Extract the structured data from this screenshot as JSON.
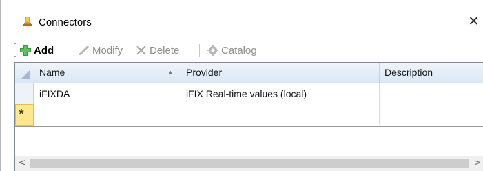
{
  "window": {
    "title": "Connectors",
    "close_glyph": "✕"
  },
  "toolbar": {
    "add_label": "Add",
    "modify_label": "Modify",
    "delete_label": "Delete",
    "catalog_label": "Catalog"
  },
  "grid": {
    "columns": [
      "Name",
      "Provider",
      "Description"
    ],
    "sorted_column": "Name",
    "rows": [
      {
        "name": "iFIXDA",
        "provider": "iFIX Real-time values (local)",
        "description": ""
      }
    ],
    "new_row_marker": "*"
  },
  "scrollbar": {
    "left_glyph": "<",
    "right_glyph": ">"
  },
  "colors": {
    "accent_green": "#3a9b3a",
    "new_row_yellow": "#ffe88c",
    "header_gradient_top": "#eef4fb"
  }
}
